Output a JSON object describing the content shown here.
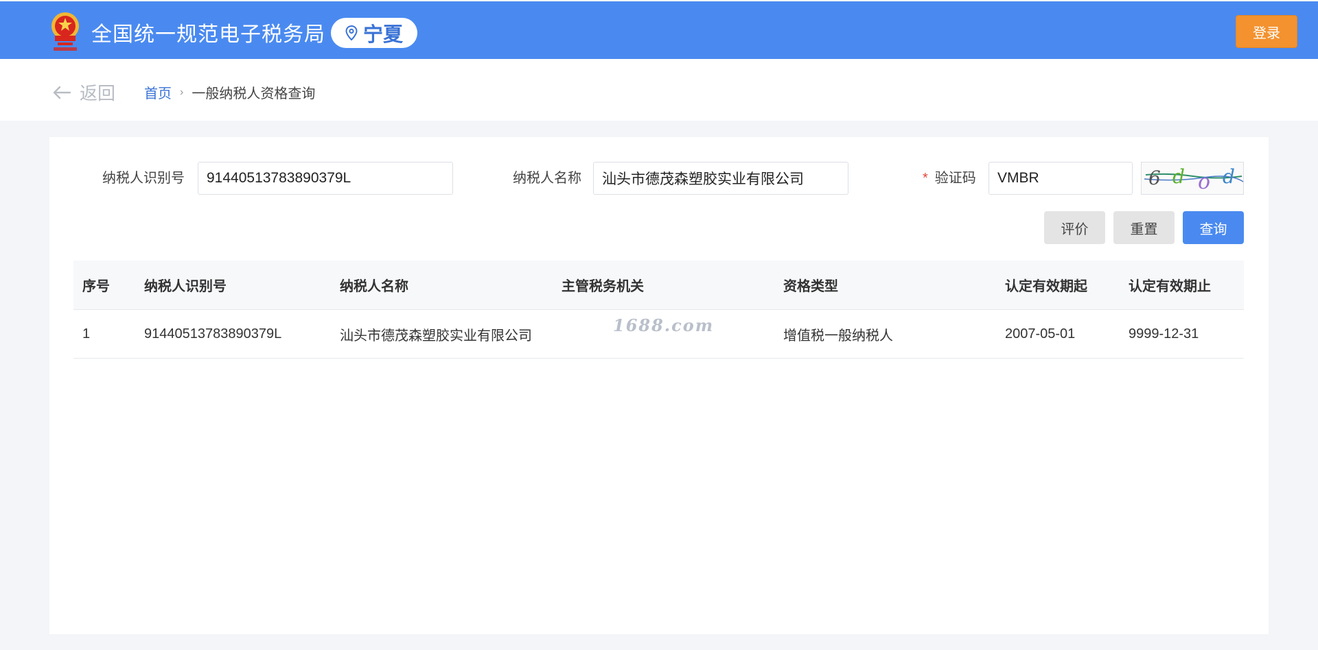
{
  "header": {
    "site_title": "全国统一规范电子税务局",
    "region": "宁夏",
    "login_label": "登录",
    "emblem_icon": "national-emblem-icon",
    "region_icon": "location-pin-icon",
    "brand_color": "#4a8af0",
    "login_color": "#f3922f"
  },
  "nav": {
    "back_label": "返回",
    "back_icon": "arrow-left-icon",
    "breadcrumb": {
      "home": "首页",
      "separator": "›",
      "current": "一般纳税人资格查询"
    }
  },
  "form": {
    "taxpayer_id_label": "纳税人识别号",
    "taxpayer_id_value": "91440513783890379L",
    "taxpayer_name_label": "纳税人名称",
    "taxpayer_name_value": "汕头市德茂森塑胶实业有限公司",
    "captcha_required_mark": "*",
    "captcha_label": "验证码",
    "captcha_value": "VMBR",
    "captcha_image_text": "6dod",
    "buttons": {
      "evaluate": "评价",
      "reset": "重置",
      "query": "查询"
    }
  },
  "table": {
    "columns": [
      "序号",
      "纳税人识别号",
      "纳税人名称",
      "主管税务机关",
      "资格类型",
      "认定有效期起",
      "认定有效期止"
    ],
    "rows": [
      [
        "1",
        "91440513783890379L",
        "汕头市德茂森塑胶实业有限公司",
        "",
        "增值税一般纳税人",
        "2007-05-01",
        "9999-12-31"
      ]
    ]
  },
  "watermark": "1688.com"
}
